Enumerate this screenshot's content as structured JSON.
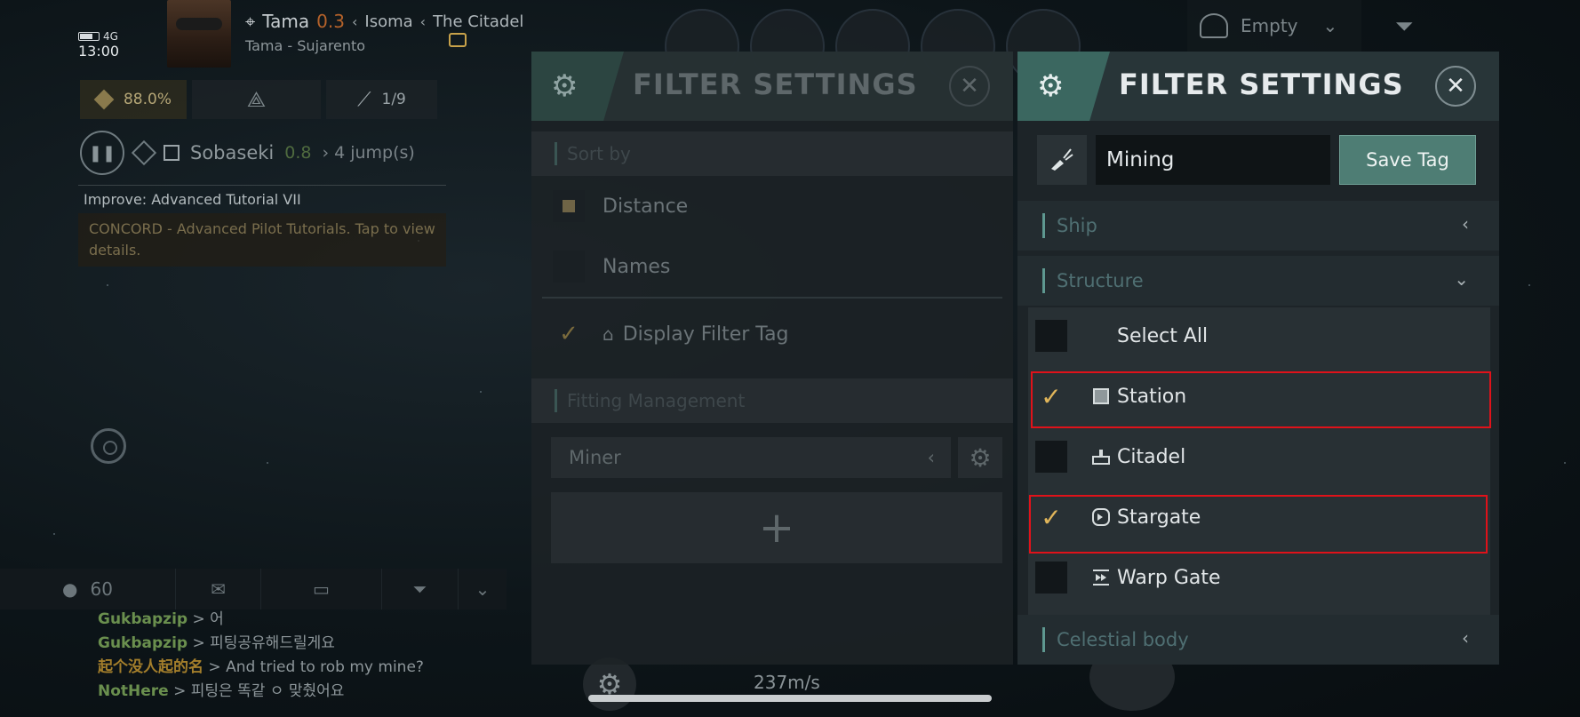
{
  "hud": {
    "network": "4G",
    "time": "13:00",
    "location": {
      "system": "Tama",
      "security": "0.3",
      "constellation": "Isoma",
      "structure": "The Citadel",
      "subtitle": "Tama - Sujarento"
    },
    "cargo_percent": "88.0%",
    "progress": "1/9",
    "route": {
      "destination": "Sobaseki",
      "security": "0.8",
      "jumps": "4 jump(s)"
    },
    "mission": {
      "title": "Improve: Advanced Tutorial VII",
      "description": "CONCORD - Advanced Pilot Tutorials. Tap to view details."
    },
    "storage_label": "Empty",
    "speed": "237m/s"
  },
  "chat": {
    "member_count": "60",
    "messages": [
      {
        "sender": "Gukbapzip",
        "text": "어"
      },
      {
        "sender": "Gukbapzip",
        "text": "피팅공유해드릴게요"
      },
      {
        "sender": "起个没人起的名",
        "text": "And tried to rob my mine?"
      },
      {
        "sender": "NotHere",
        "text": "피팅은 똑같 ㅇ 맞췄어요"
      }
    ]
  },
  "dim_panel": {
    "title": "FILTER SETTINGS",
    "sort_header": "Sort by",
    "sort_options": [
      "Distance",
      "Names"
    ],
    "display_tag_label": "Display Filter Tag",
    "fitting_header": "Fitting Management",
    "fitting_value": "Miner",
    "add_symbol": "+"
  },
  "panel": {
    "title": "FILTER SETTINGS",
    "tag_value": "Mining",
    "save_label": "Save Tag",
    "sections": {
      "ship": "Ship",
      "structure": "Structure",
      "celestial": "Celestial body"
    },
    "structure_items": [
      {
        "label": "Select All",
        "checked": false
      },
      {
        "label": "Station",
        "checked": true,
        "icon": "station-icon"
      },
      {
        "label": "Citadel",
        "checked": false,
        "icon": "citadel-icon"
      },
      {
        "label": "Stargate",
        "checked": true,
        "icon": "stargate-icon"
      },
      {
        "label": "Warp Gate",
        "checked": false,
        "icon": "warp-gate-icon"
      }
    ]
  },
  "colors": {
    "accent": "#4e7d74",
    "highlight": "#e0121a",
    "check": "#e0b55a"
  }
}
